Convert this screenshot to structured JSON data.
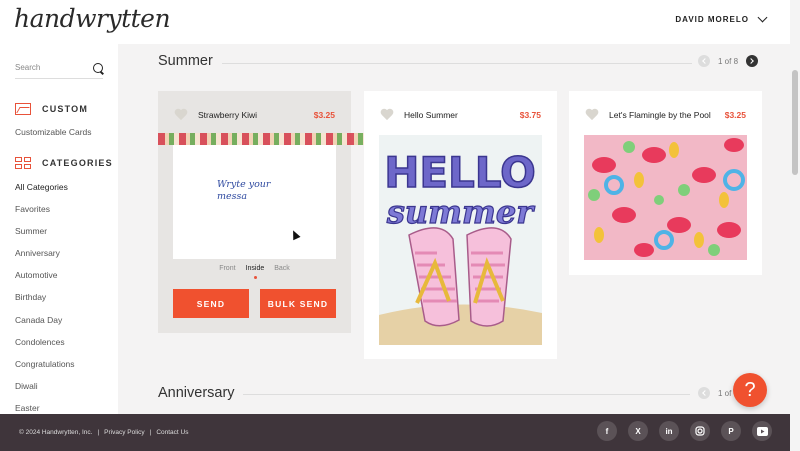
{
  "header": {
    "logo": "handwrytten",
    "user_name": "DAVID MORELO"
  },
  "sidebar": {
    "search_placeholder": "Search",
    "custom_heading": "CUSTOM",
    "custom_items": [
      "Customizable Cards"
    ],
    "categories_heading": "CATEGORIES",
    "categories": [
      "All Categories",
      "Favorites",
      "Summer",
      "Anniversary",
      "Automotive",
      "Birthday",
      "Canada Day",
      "Condolences",
      "Congratulations",
      "Diwali",
      "Easter"
    ]
  },
  "sections": [
    {
      "title": "Summer",
      "pager": "1 of 8"
    },
    {
      "title": "Anniversary",
      "pager": "1 of"
    }
  ],
  "cards": [
    {
      "name": "Strawberry Kiwi",
      "price": "$3.25",
      "handwriting_line1": "Wryte your",
      "handwriting_line2": "messa"
    },
    {
      "name": "Hello Summer",
      "price": "$3.75",
      "art_text_1": "HELLO",
      "art_text_2": "summer"
    },
    {
      "name": "Let's Flamingle by the Pool",
      "price": "$3.25"
    }
  ],
  "card_views": [
    "Front",
    "Inside",
    "Back"
  ],
  "actions": {
    "send": "SEND",
    "bulk_send": "BULK SEND"
  },
  "help_glyph": "?",
  "footer": {
    "copyright": "© 2024 Handwrytten, Inc.",
    "sep": "|",
    "privacy": "Privacy Policy",
    "contact": "Contact Us",
    "socials": [
      "facebook-icon",
      "x-icon",
      "linkedin-icon",
      "instagram-icon",
      "pinterest-icon",
      "youtube-icon"
    ]
  },
  "colors": {
    "accent": "#f0512f",
    "price": "#e8523a",
    "footer_bg": "#3f353b"
  }
}
